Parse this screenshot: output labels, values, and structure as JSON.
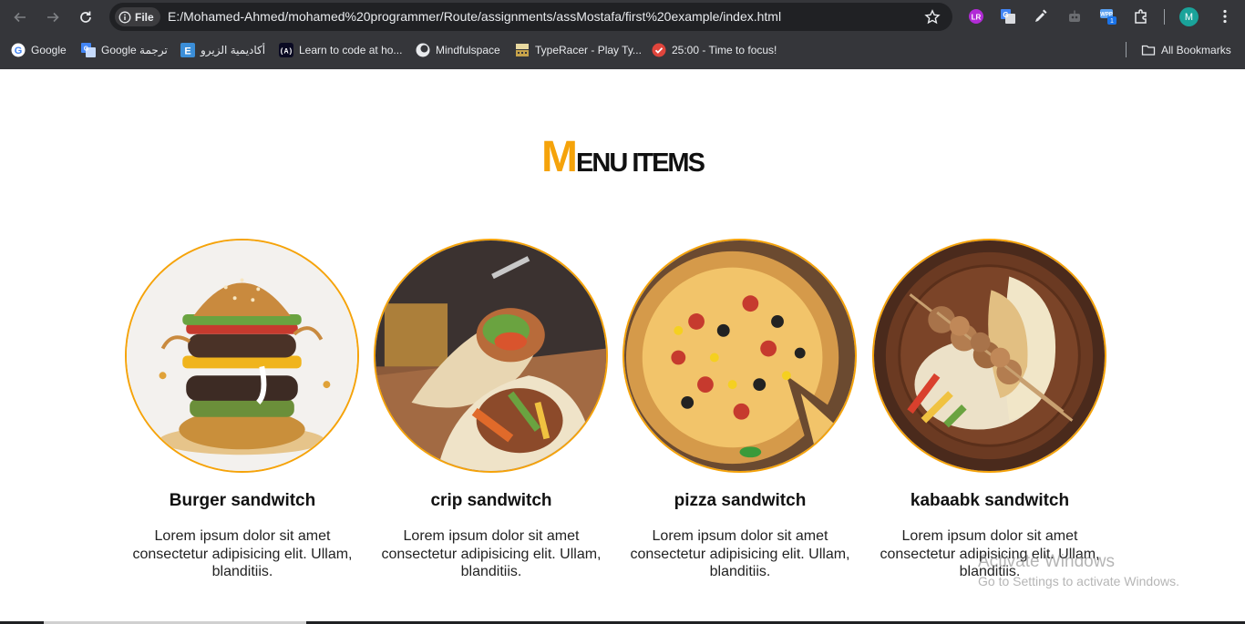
{
  "browser": {
    "url": "E:/Mohamed-Ahmed/mohamed%20programmer/Route/assignments/assMostafa/first%20example/index.html",
    "scheme_chip": "File",
    "profile_initial": "M",
    "bookmarks": [
      {
        "label": "Google",
        "icon": "google-icon"
      },
      {
        "label": "Google ترجمة",
        "icon": "translate-icon"
      },
      {
        "label": "أكاديمية الزيرو",
        "icon": "academy-icon"
      },
      {
        "label": "Learn to code at ho...",
        "icon": "code-icon"
      },
      {
        "label": "Mindfulspace",
        "icon": "mindfulspace-icon"
      },
      {
        "label": "TypeRacer - Play Ty...",
        "icon": "typeracer-icon"
      },
      {
        "label": "25:00 - Time to focus!",
        "icon": "pomodoro-icon"
      }
    ],
    "all_bookmarks_label": "All Bookmarks"
  },
  "page": {
    "heading_first": "M",
    "heading_rest": "enu items",
    "accent_color": "#f5a30a",
    "items": [
      {
        "title": "Burger sandwitch",
        "description": "Lorem ipsum dolor sit amet consectetur adipisicing elit. Ullam, blanditiis.",
        "image": "burger-image"
      },
      {
        "title": "crip sandwitch",
        "description": "Lorem ipsum dolor sit amet consectetur adipisicing elit. Ullam, blanditiis.",
        "image": "wrap-image"
      },
      {
        "title": "pizza sandwitch",
        "description": "Lorem ipsum dolor sit amet consectetur adipisicing elit. Ullam, blanditiis.",
        "image": "pizza-image"
      },
      {
        "title": "kabaabk sandwitch",
        "description": "Lorem ipsum dolor sit amet consectetur adipisicing elit. Ullam, blanditiis.",
        "image": "kebab-image"
      }
    ]
  },
  "watermark": {
    "line1": "Activate Windows",
    "line2": "Go to Settings to activate Windows."
  }
}
